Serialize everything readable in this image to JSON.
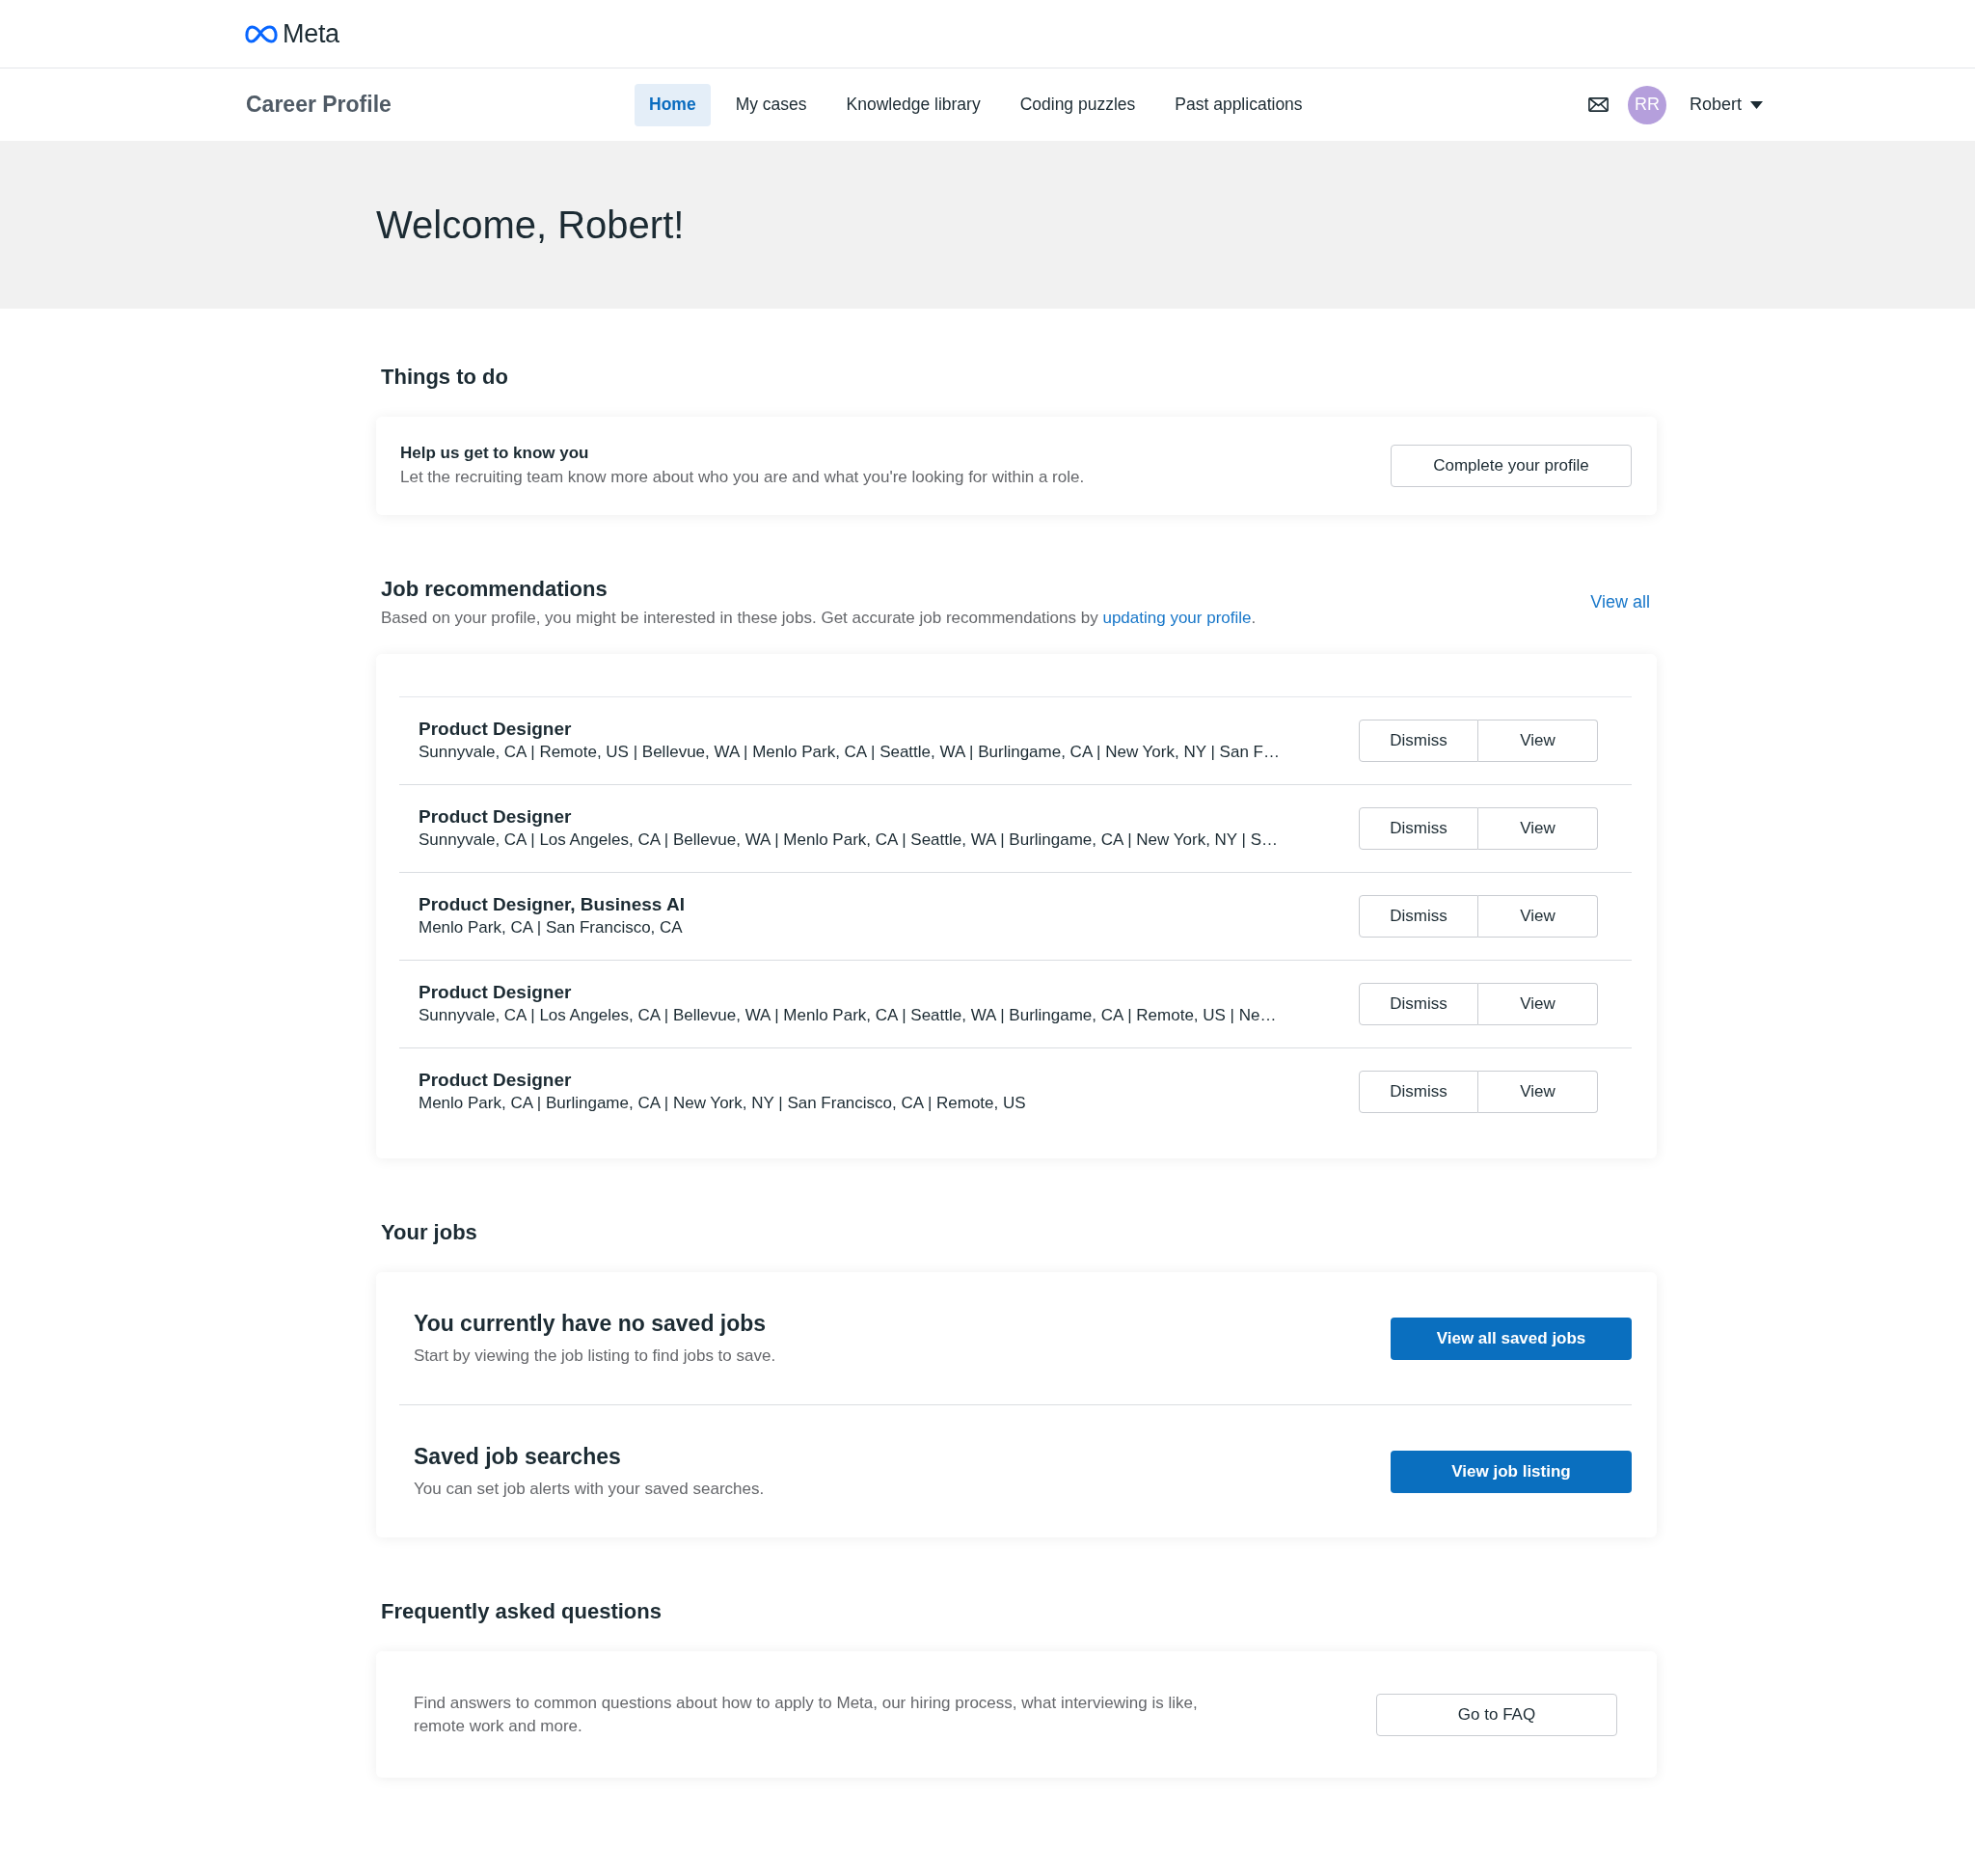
{
  "brand": {
    "name": "Meta"
  },
  "nav": {
    "title": "Career Profile",
    "tabs": [
      {
        "label": "Home",
        "selected": true
      },
      {
        "label": "My cases",
        "selected": false
      },
      {
        "label": "Knowledge library",
        "selected": false
      },
      {
        "label": "Coding puzzles",
        "selected": false
      },
      {
        "label": "Past applications",
        "selected": false
      }
    ],
    "user": {
      "initials": "RR",
      "name": "Robert"
    }
  },
  "banner": {
    "greeting": "Welcome, Robert!"
  },
  "things_to_do": {
    "heading": "Things to do",
    "title": "Help us get to know you",
    "description": "Let the recruiting team know more about who you are and what you're looking for within a role.",
    "button": "Complete your profile"
  },
  "job_recommendations": {
    "heading": "Job recommendations",
    "description": "Based on your profile, you might be interested in these jobs. Get accurate job recommendations by",
    "link": "updating your profile",
    "description_end": ".",
    "view_all": "View all",
    "jobs": [
      {
        "title": "Product Designer",
        "locations": "Sunnyvale, CA | Remote, US | Bellevue, WA | Menlo Park, CA | Seattle, WA | Burlingame, CA | New York, NY | San F…",
        "dismiss": "Dismiss",
        "view": "View"
      },
      {
        "title": "Product Designer",
        "locations": "Sunnyvale, CA | Los Angeles, CA | Bellevue, WA | Menlo Park, CA | Seattle, WA | Burlingame, CA | New York, NY | S…",
        "dismiss": "Dismiss",
        "view": "View"
      },
      {
        "title": "Product Designer, Business AI",
        "locations": "Menlo Park, CA | San Francisco, CA",
        "dismiss": "Dismiss",
        "view": "View"
      },
      {
        "title": "Product Designer",
        "locations": "Sunnyvale, CA | Los Angeles, CA | Bellevue, WA | Menlo Park, CA | Seattle, WA | Burlingame, CA | Remote, US | Ne…",
        "dismiss": "Dismiss",
        "view": "View"
      },
      {
        "title": "Product Designer",
        "locations": "Menlo Park, CA | Burlingame, CA | New York, NY | San Francisco, CA | Remote, US",
        "dismiss": "Dismiss",
        "view": "View"
      }
    ]
  },
  "your_jobs": {
    "heading": "Your jobs",
    "sections": [
      {
        "title": "You currently have no saved jobs",
        "description": "Start by viewing the job listing to find jobs to save.",
        "button": "View all saved jobs"
      },
      {
        "title": "Saved job searches",
        "description": "You can set job alerts with your saved searches.",
        "button": "View job listing"
      }
    ]
  },
  "faq": {
    "heading": "Frequently asked questions",
    "description": "Find answers to common questions about how to apply to Meta, our hiring process, what interviewing is like, remote work and more.",
    "button": "Go to FAQ"
  }
}
